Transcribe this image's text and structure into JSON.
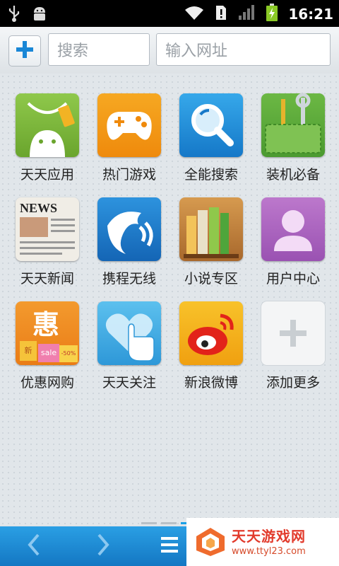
{
  "status_bar": {
    "time": "16:21",
    "icons": [
      "usb-icon",
      "android-debug-icon",
      "wifi-icon",
      "sim-alert-icon",
      "signal-icon",
      "battery-charging-icon"
    ]
  },
  "toolbar": {
    "add_icon": "plus-icon",
    "search_placeholder": "搜索",
    "url_placeholder": "输入网址"
  },
  "grid": {
    "items": [
      {
        "label": "天天应用",
        "icon": "android-shopping-bag-icon",
        "color": "#7dbb3a"
      },
      {
        "label": "热门游戏",
        "icon": "gamepad-icon",
        "color": "#f39a16"
      },
      {
        "label": "全能搜索",
        "icon": "magnifier-globe-icon",
        "color": "#1c8fd8"
      },
      {
        "label": "装机必备",
        "icon": "tools-pocket-icon",
        "color": "#5aa33a"
      },
      {
        "label": "天天新闻",
        "icon": "newspaper-icon",
        "color": "#e9e6df"
      },
      {
        "label": "携程无线",
        "icon": "dolphin-icon",
        "color": "#1f7fd1"
      },
      {
        "label": "小说专区",
        "icon": "books-icon",
        "color": "#c8873f"
      },
      {
        "label": "用户中心",
        "icon": "user-silhouette-icon",
        "color": "#b067c2"
      },
      {
        "label": "优惠网购",
        "icon": "shopping-bags-sale-icon",
        "color": "#f08a22"
      },
      {
        "label": "天天关注",
        "icon": "heart-hand-icon",
        "color": "#48b2e6"
      },
      {
        "label": "新浪微博",
        "icon": "weibo-icon",
        "color": "#f5b21a"
      },
      {
        "label": "添加更多",
        "icon": "add-more-icon",
        "color": "#f2f3f4"
      }
    ],
    "icon_text": {
      "news": "NEWS",
      "hui": "惠",
      "sale": "sale",
      "discount": "-50%",
      "xin": "新"
    }
  },
  "pager": {
    "pages": 3,
    "current": 3
  },
  "bottom_bar": {
    "icons": [
      "back-arrow-icon",
      "forward-arrow-icon",
      "menu-icon"
    ]
  },
  "watermark": {
    "title": "天天游戏网",
    "url": "www.ttyl23.com"
  }
}
